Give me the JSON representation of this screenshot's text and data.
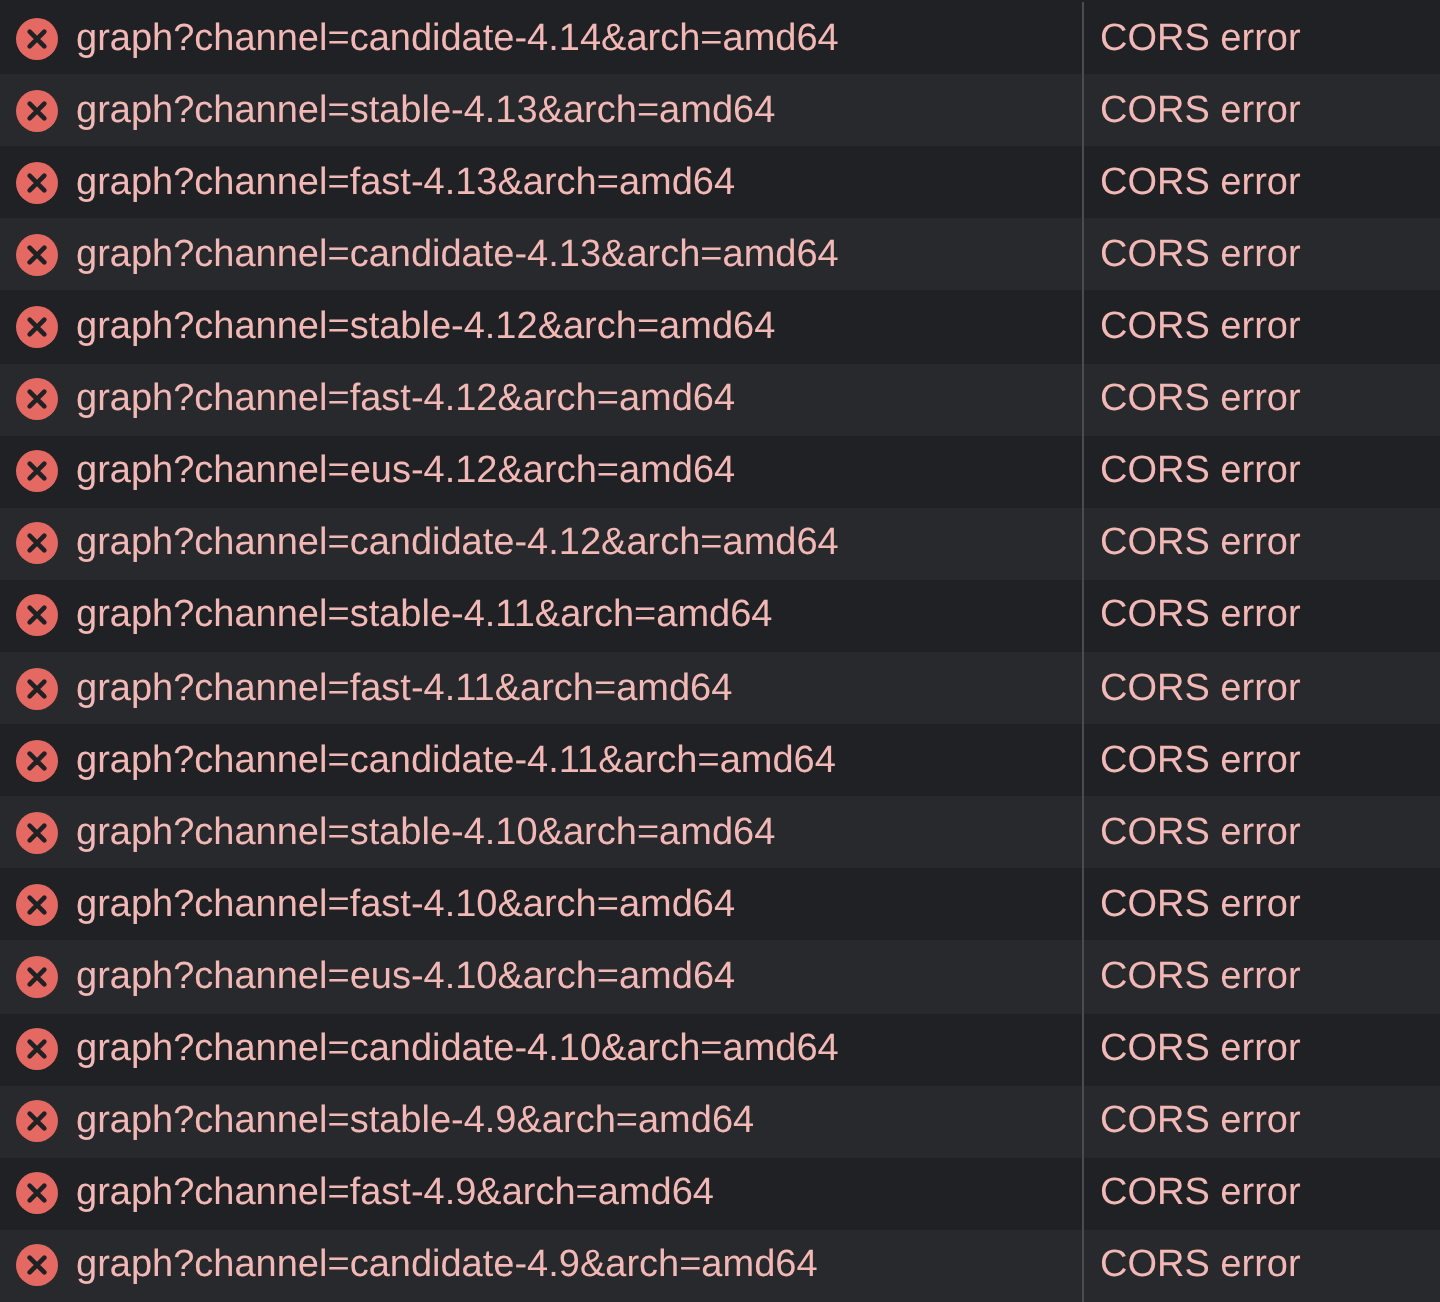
{
  "requests": [
    {
      "name": "graph?channel=candidate-4.14&arch=amd64",
      "status": "CORS error"
    },
    {
      "name": "graph?channel=stable-4.13&arch=amd64",
      "status": "CORS error"
    },
    {
      "name": "graph?channel=fast-4.13&arch=amd64",
      "status": "CORS error"
    },
    {
      "name": "graph?channel=candidate-4.13&arch=amd64",
      "status": "CORS error"
    },
    {
      "name": "graph?channel=stable-4.12&arch=amd64",
      "status": "CORS error"
    },
    {
      "name": "graph?channel=fast-4.12&arch=amd64",
      "status": "CORS error"
    },
    {
      "name": "graph?channel=eus-4.12&arch=amd64",
      "status": "CORS error"
    },
    {
      "name": "graph?channel=candidate-4.12&arch=amd64",
      "status": "CORS error"
    },
    {
      "name": "graph?channel=stable-4.11&arch=amd64",
      "status": "CORS error"
    },
    {
      "name": "graph?channel=fast-4.11&arch=amd64",
      "status": "CORS error"
    },
    {
      "name": "graph?channel=candidate-4.11&arch=amd64",
      "status": "CORS error"
    },
    {
      "name": "graph?channel=stable-4.10&arch=amd64",
      "status": "CORS error"
    },
    {
      "name": "graph?channel=fast-4.10&arch=amd64",
      "status": "CORS error"
    },
    {
      "name": "graph?channel=eus-4.10&arch=amd64",
      "status": "CORS error"
    },
    {
      "name": "graph?channel=candidate-4.10&arch=amd64",
      "status": "CORS error"
    },
    {
      "name": "graph?channel=stable-4.9&arch=amd64",
      "status": "CORS error"
    },
    {
      "name": "graph?channel=fast-4.9&arch=amd64",
      "status": "CORS error"
    },
    {
      "name": "graph?channel=candidate-4.9&arch=amd64",
      "status": "CORS error"
    }
  ]
}
